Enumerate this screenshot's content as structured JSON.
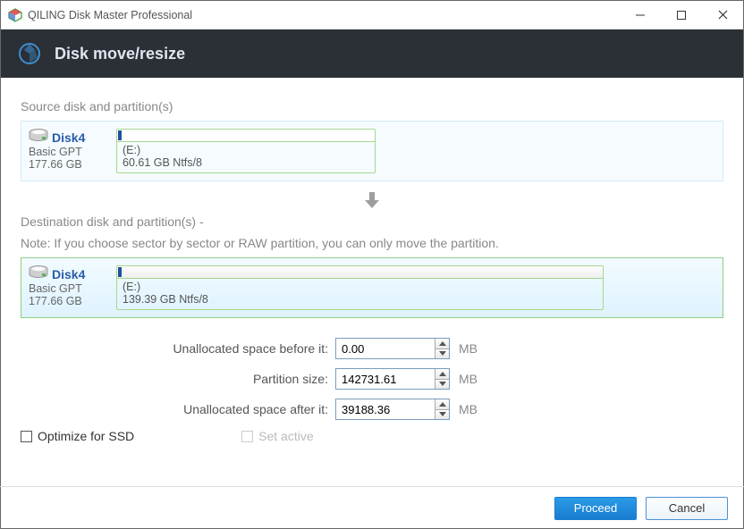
{
  "window": {
    "title": "QILING Disk Master Professional"
  },
  "header": {
    "heading": "Disk move/resize"
  },
  "source": {
    "label": "Source disk and partition(s)",
    "disk_name": "Disk4",
    "disk_type": "Basic GPT",
    "disk_size": "177.66 GB",
    "part_letter": "(E:)",
    "part_desc": "60.61 GB Ntfs/8"
  },
  "destination": {
    "label": "Destination disk and partition(s) -",
    "note": "Note: If you choose sector by sector or RAW partition, you can only move the partition.",
    "disk_name": "Disk4",
    "disk_type": "Basic GPT",
    "disk_size": "177.66 GB",
    "part_letter": "(E:)",
    "part_desc": "139.39 GB Ntfs/8"
  },
  "form": {
    "unalloc_before_label": "Unallocated space before it:",
    "unalloc_before_value": "0.00",
    "partition_size_label": "Partition size:",
    "partition_size_value": "142731.61",
    "unalloc_after_label": "Unallocated space after it:",
    "unalloc_after_value": "39188.36",
    "unit": "MB"
  },
  "checks": {
    "optimize_ssd": "Optimize for SSD",
    "set_active": "Set active"
  },
  "buttons": {
    "proceed": "Proceed",
    "cancel": "Cancel"
  }
}
